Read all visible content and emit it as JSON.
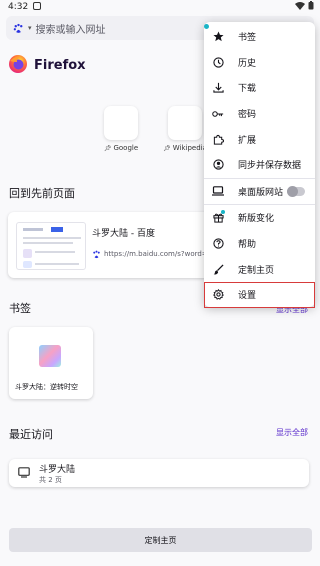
{
  "status_bar": {
    "time": "4:32"
  },
  "toolbar": {
    "search_placeholder": "搜索或输入网址"
  },
  "logo": {
    "name": "Firefox"
  },
  "shortcuts": [
    {
      "label": "Google"
    },
    {
      "label": "Wikipedia"
    }
  ],
  "recent": {
    "title": "回到先前页面",
    "card_title": "斗罗大陆 - 百度",
    "card_url": "https://m.baidu.com/s?word=%E6%"
  },
  "bookmarks": {
    "title": "书签",
    "show_all": "显示全部",
    "item_label": "斗罗大陆：逆转时空"
  },
  "history": {
    "title": "最近访问",
    "show_all": "显示全部",
    "item_title": "斗罗大陆",
    "item_sub": "共 2 页"
  },
  "customize_button": "定制主页",
  "menu": {
    "items": [
      {
        "label": "书签",
        "icon": "star-icon"
      },
      {
        "label": "历史",
        "icon": "clock-icon"
      },
      {
        "label": "下载",
        "icon": "download-icon"
      },
      {
        "label": "密码",
        "icon": "key-icon"
      },
      {
        "label": "扩展",
        "icon": "puzzle-icon"
      },
      {
        "label": "同步并保存数据",
        "icon": "account-icon"
      },
      {
        "label": "桌面版网站",
        "icon": "desktop-icon",
        "toggle": false
      },
      {
        "label": "新版变化",
        "icon": "gift-icon"
      },
      {
        "label": "帮助",
        "icon": "help-icon"
      },
      {
        "label": "定制主页",
        "icon": "brush-icon"
      },
      {
        "label": "设置",
        "icon": "gear-icon",
        "highlighted": true
      }
    ]
  },
  "colors": {
    "accent": "#592acb",
    "highlight_border": "#d73b3b",
    "notification_dot": "#1ab4c6"
  }
}
